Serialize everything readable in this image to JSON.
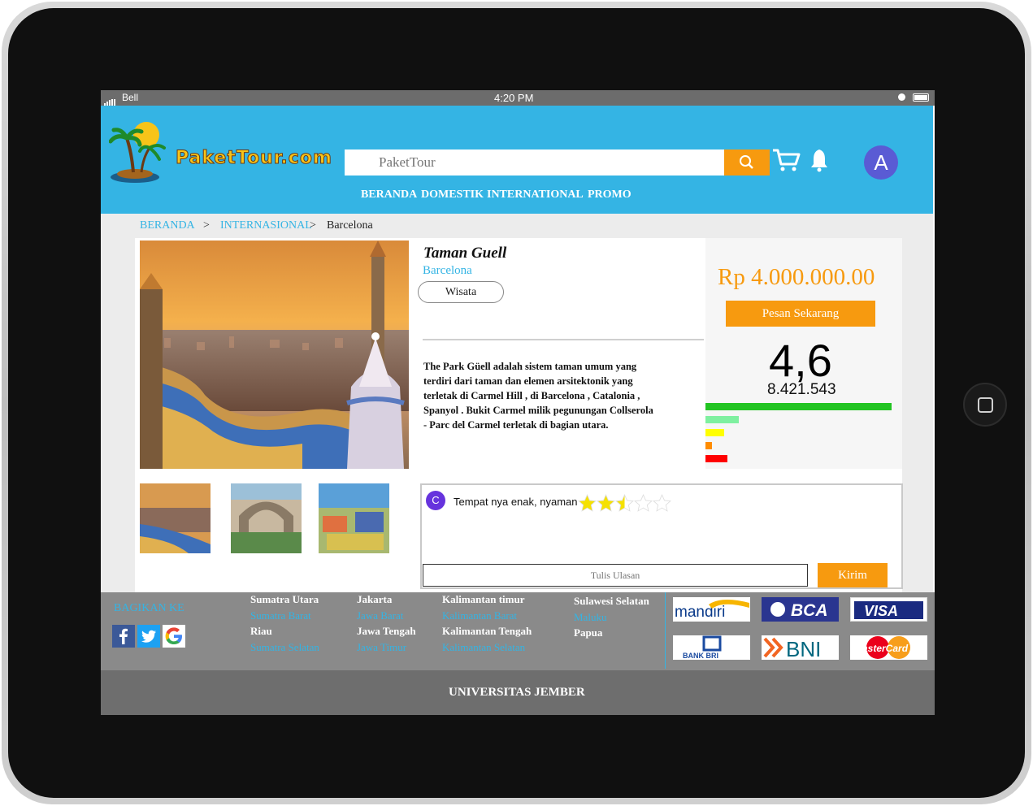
{
  "status_bar": {
    "carrier": "Bell",
    "time": "4:20 PM"
  },
  "header": {
    "logo_text": "PaketTour.com",
    "search_placeholder": "PaketTour",
    "avatar_initial": "A",
    "nav": [
      "BERANDA",
      "DOMESTIK",
      "INTERNATIONAL",
      "PROMO"
    ]
  },
  "breadcrumb": {
    "home": "BERANDA",
    "sep1": ">",
    "category": "INTERNASIONAL",
    "sep2": ">",
    "current": "Barcelona"
  },
  "product": {
    "title": "Taman Guell",
    "city": "Barcelona",
    "tag": "Wisata",
    "description": "The Park Güell adalah sistem taman umum yang terdiri dari taman dan elemen arsitektonik yang terletak di Carmel Hill , di Barcelona , Catalonia , Spanyol . Bukit Carmel milik pegunungan Collserola - Parc del Carmel terletak di bagian utara.",
    "price": "Rp 4.000.000.00",
    "order_button": "Pesan Sekarang",
    "rating": "4,6",
    "rating_count": "8.421.543",
    "rating_distribution": [
      {
        "stars": 5,
        "fraction": 1.0,
        "color": "#22c422"
      },
      {
        "stars": 4,
        "fraction": 0.18,
        "color": "#7ff0a0"
      },
      {
        "stars": 3,
        "fraction": 0.1,
        "color": "#ffff00"
      },
      {
        "stars": 2,
        "fraction": 0.035,
        "color": "#ff8c00"
      },
      {
        "stars": 1,
        "fraction": 0.12,
        "color": "#ff0000"
      }
    ]
  },
  "review": {
    "reviewer_initial": "C",
    "text": "Tempat nya enak, nyaman",
    "stars": 2.5,
    "stars_max": 5,
    "input_placeholder": "Tulis Ulasan",
    "send_button": "Kirim"
  },
  "footer": {
    "share_label": "BAGIKAN KE",
    "regions": [
      {
        "name": "Sumatra Utara",
        "style": "white"
      },
      {
        "name": "Sumatra Barat",
        "style": "blue"
      },
      {
        "name": "Riau",
        "style": "white"
      },
      {
        "name": "Sumatra Selatan",
        "style": "blue"
      },
      {
        "name": "Jakarta",
        "style": "white"
      },
      {
        "name": "Jawa Barat",
        "style": "blue"
      },
      {
        "name": "Jawa Tengah",
        "style": "white"
      },
      {
        "name": "Jawa Timur",
        "style": "blue"
      },
      {
        "name": "Kalimantan timur",
        "style": "white"
      },
      {
        "name": "Kalimantan Barat",
        "style": "blue"
      },
      {
        "name": "Kalimantan Tengah",
        "style": "white"
      },
      {
        "name": "Kalimantan Selatan",
        "style": "blue"
      },
      {
        "name": "Sulawesi Selatan",
        "style": "white"
      },
      {
        "name": "Maluku",
        "style": "blue"
      },
      {
        "name": "Papua",
        "style": "white"
      }
    ],
    "payments": [
      "mandiri",
      "BCA",
      "VISA",
      "BANK BRI",
      "BNI",
      "MasterCard"
    ],
    "university": "UNIVERSITAS JEMBER"
  },
  "colors": {
    "accent": "#34b4e4",
    "orange": "#f79a0f",
    "footer": "#8a8a8a"
  }
}
